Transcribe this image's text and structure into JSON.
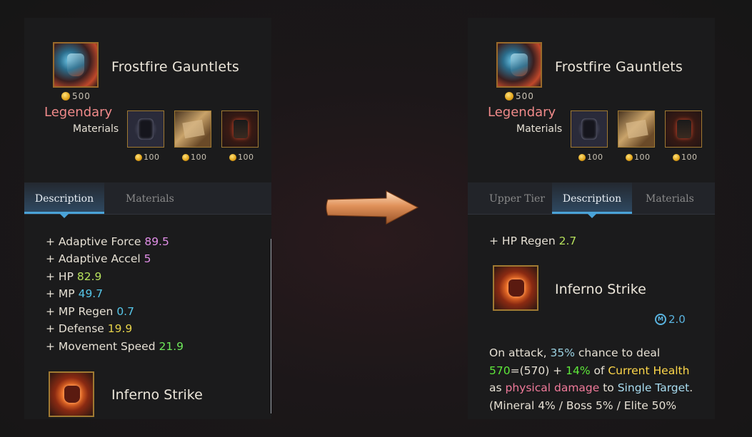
{
  "left": {
    "item_name": "Frostfire Gauntlets",
    "price": "500",
    "rarity": "Legendary",
    "materials_label": "Materials",
    "material_prices": [
      "100",
      "100",
      "100"
    ],
    "tabs": [
      "Description",
      "Materials"
    ],
    "stats": [
      {
        "label": "+ Adaptive Force",
        "value": "89.5"
      },
      {
        "label": "+ Adaptive Accel",
        "value": "5"
      },
      {
        "label": "+ HP",
        "value": "82.9"
      },
      {
        "label": "+ MP",
        "value": "49.7"
      },
      {
        "label": "+ MP Regen",
        "value": "0.7"
      },
      {
        "label": "+ Defense",
        "value": "19.9"
      },
      {
        "label": "+ Movement Speed",
        "value": "21.9"
      }
    ],
    "skill_name": "Inferno Strike"
  },
  "right": {
    "item_name": "Frostfire Gauntlets",
    "price": "500",
    "rarity": "Legendary",
    "materials_label": "Materials",
    "material_prices": [
      "100",
      "100",
      "100"
    ],
    "tabs": [
      "Upper Tier",
      "Description",
      "Materials"
    ],
    "stat_label": "+ HP Regen",
    "stat_value": "2.7",
    "skill_name": "Inferno Strike",
    "cooldown": "2.0",
    "cooldown_icon_text": "M",
    "desc": {
      "d1": "On attack, ",
      "d2": "35%",
      "d3": " chance to  deal",
      "d4": "570",
      "d5": "=(570)  + ",
      "d6": "14%",
      "d7": " of ",
      "d8": "Current Health",
      "d9": "as ",
      "d10": "physical damage",
      "d11": " to ",
      "d12": "Single Target",
      "d13": ".",
      "d14": "(Mineral 4% / Boss 5% / Elite 50%"
    }
  },
  "colors": {
    "legendary": "#f08a8a",
    "accent_tab": "#4aa3d8",
    "border_gold": "#a07a32"
  }
}
